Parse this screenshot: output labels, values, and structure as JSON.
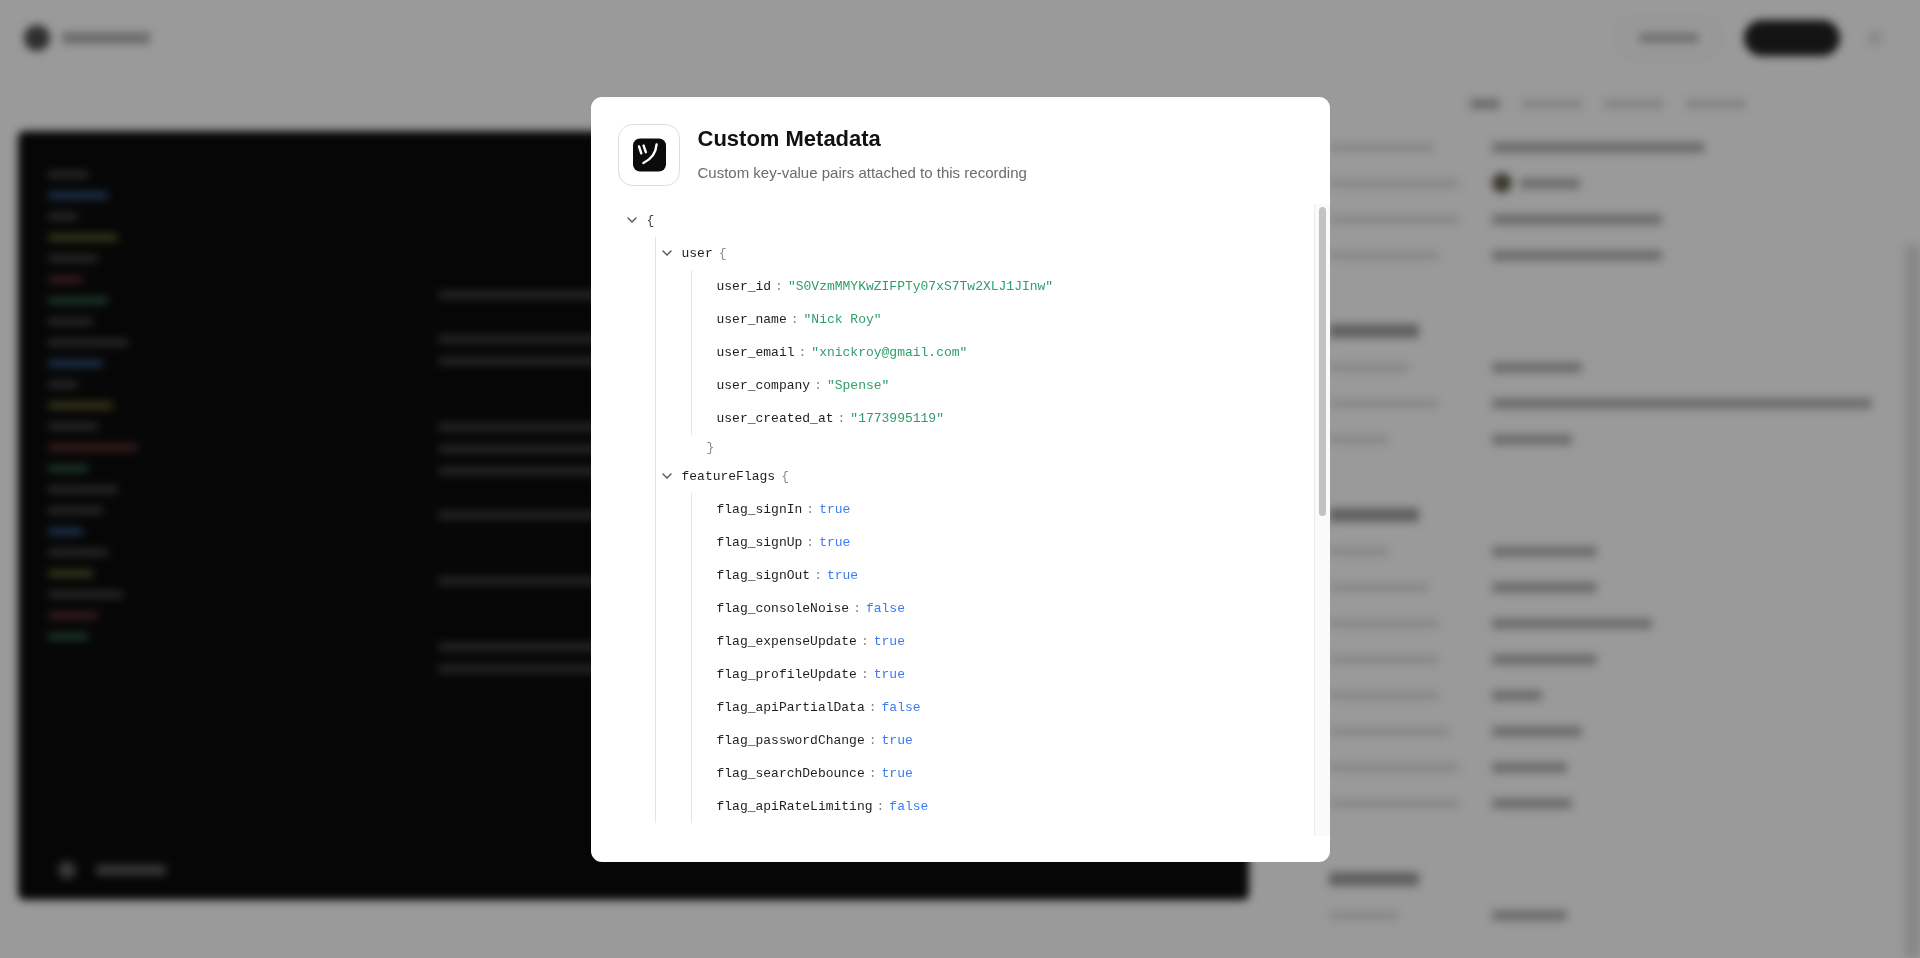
{
  "dialog": {
    "title": "Custom Metadata",
    "subtitle": "Custom key-value pairs attached to this recording"
  },
  "tree": {
    "open_brace": "{",
    "expanded": true,
    "children": [
      {
        "key": "user",
        "open_brace": "{",
        "expanded": true,
        "children": [
          {
            "key": "user_id",
            "colon": ":",
            "value": "\"S0VzmMMYKwZIFPTy07xS7Tw2XLJ1JInw\"",
            "kind": "string"
          },
          {
            "key": "user_name",
            "colon": ":",
            "value": "\"Nick Roy\"",
            "kind": "string"
          },
          {
            "key": "user_email",
            "colon": ":",
            "value": "\"xnickroy@gmail.com\"",
            "kind": "string"
          },
          {
            "key": "user_company",
            "colon": ":",
            "value": "\"Spense\"",
            "kind": "string"
          },
          {
            "key": "user_created_at",
            "colon": ":",
            "value": "\"1773995119\"",
            "kind": "string"
          }
        ],
        "close_brace": "}"
      },
      {
        "key": "featureFlags",
        "open_brace": "{",
        "expanded": true,
        "children": [
          {
            "key": "flag_signIn",
            "colon": ":",
            "value": "true",
            "kind": "boolean"
          },
          {
            "key": "flag_signUp",
            "colon": ":",
            "value": "true",
            "kind": "boolean"
          },
          {
            "key": "flag_signOut",
            "colon": ":",
            "value": "true",
            "kind": "boolean"
          },
          {
            "key": "flag_consoleNoise",
            "colon": ":",
            "value": "false",
            "kind": "boolean"
          },
          {
            "key": "flag_expenseUpdate",
            "colon": ":",
            "value": "true",
            "kind": "boolean"
          },
          {
            "key": "flag_profileUpdate",
            "colon": ":",
            "value": "true",
            "kind": "boolean"
          },
          {
            "key": "flag_apiPartialData",
            "colon": ":",
            "value": "false",
            "kind": "boolean"
          },
          {
            "key": "flag_passwordChange",
            "colon": ":",
            "value": "true",
            "kind": "boolean"
          },
          {
            "key": "flag_searchDebounce",
            "colon": ":",
            "value": "true",
            "kind": "boolean"
          },
          {
            "key": "flag_apiRateLimiting",
            "colon": ":",
            "value": "false",
            "kind": "boolean"
          }
        ]
      }
    ]
  }
}
